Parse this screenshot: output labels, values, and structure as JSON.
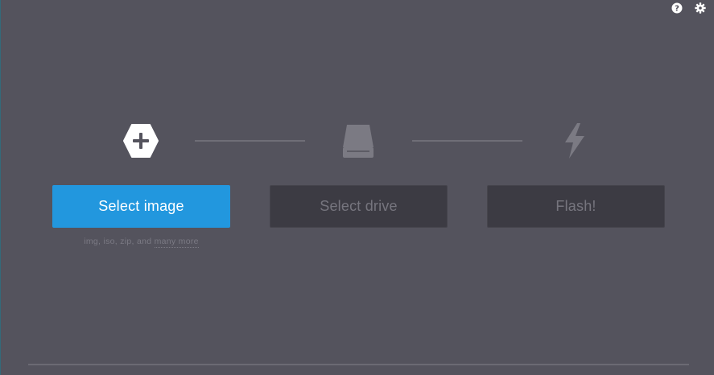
{
  "header": {
    "help_icon": "question-circle-icon",
    "settings_icon": "gear-icon"
  },
  "steps": {
    "image": {
      "icon": "plus-hexagon-icon",
      "button_label": "Select image",
      "hint_prefix": "img, iso, zip, and ",
      "hint_link": "many more"
    },
    "drive": {
      "icon": "hard-drive-icon",
      "button_label": "Select drive"
    },
    "flash": {
      "icon": "lightning-bolt-icon",
      "button_label": "Flash!"
    }
  },
  "colors": {
    "background": "#54535d",
    "primary": "#2297de",
    "disabled_button": "#3c3b43",
    "disabled_text": "#76757e"
  }
}
